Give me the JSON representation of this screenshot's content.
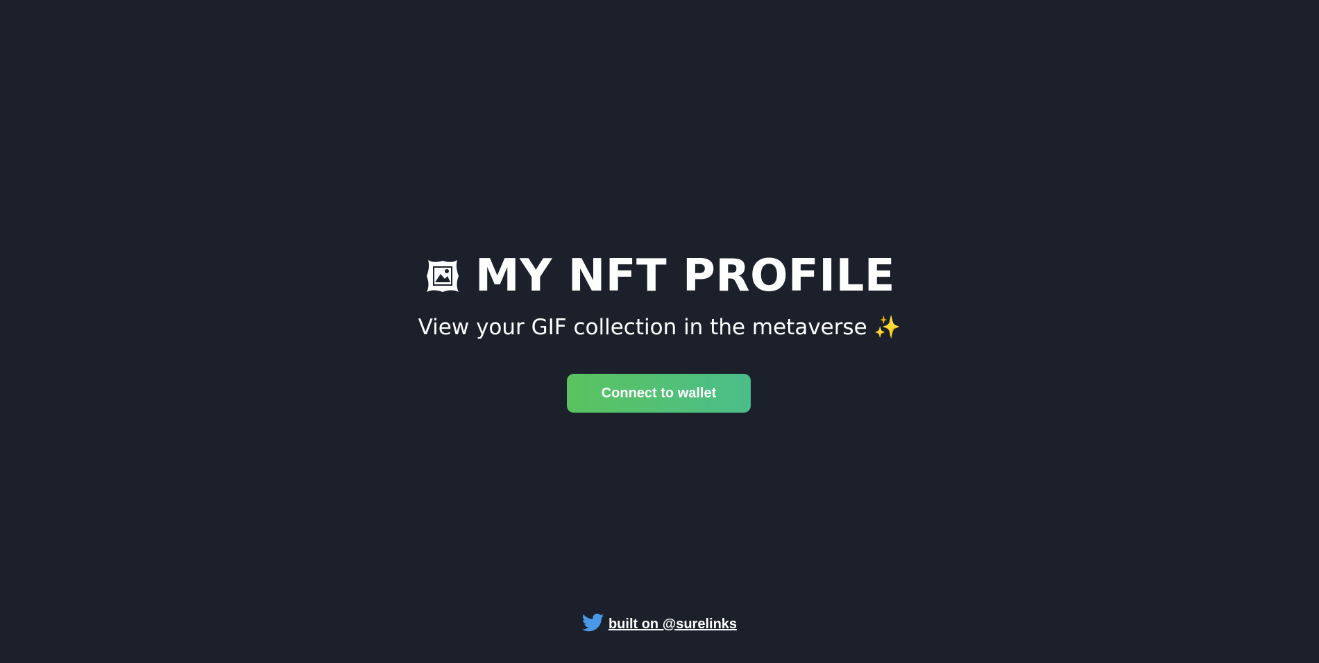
{
  "header": {
    "title": "MY NFT PROFILE",
    "subtitle": "View your GIF collection in the metaverse",
    "title_icon": "framed-picture-icon",
    "subtitle_icon": "sparkles-icon"
  },
  "actions": {
    "connect_label": "Connect to wallet"
  },
  "footer": {
    "link_text": "built on @surelinks",
    "icon": "twitter-bird-icon"
  },
  "colors": {
    "background": "#1b202b",
    "button_gradient_start": "#5ac35f",
    "button_gradient_end": "#4bbd8a",
    "twitter_blue": "#4a99e9",
    "sparkle": "#ffd84a"
  }
}
